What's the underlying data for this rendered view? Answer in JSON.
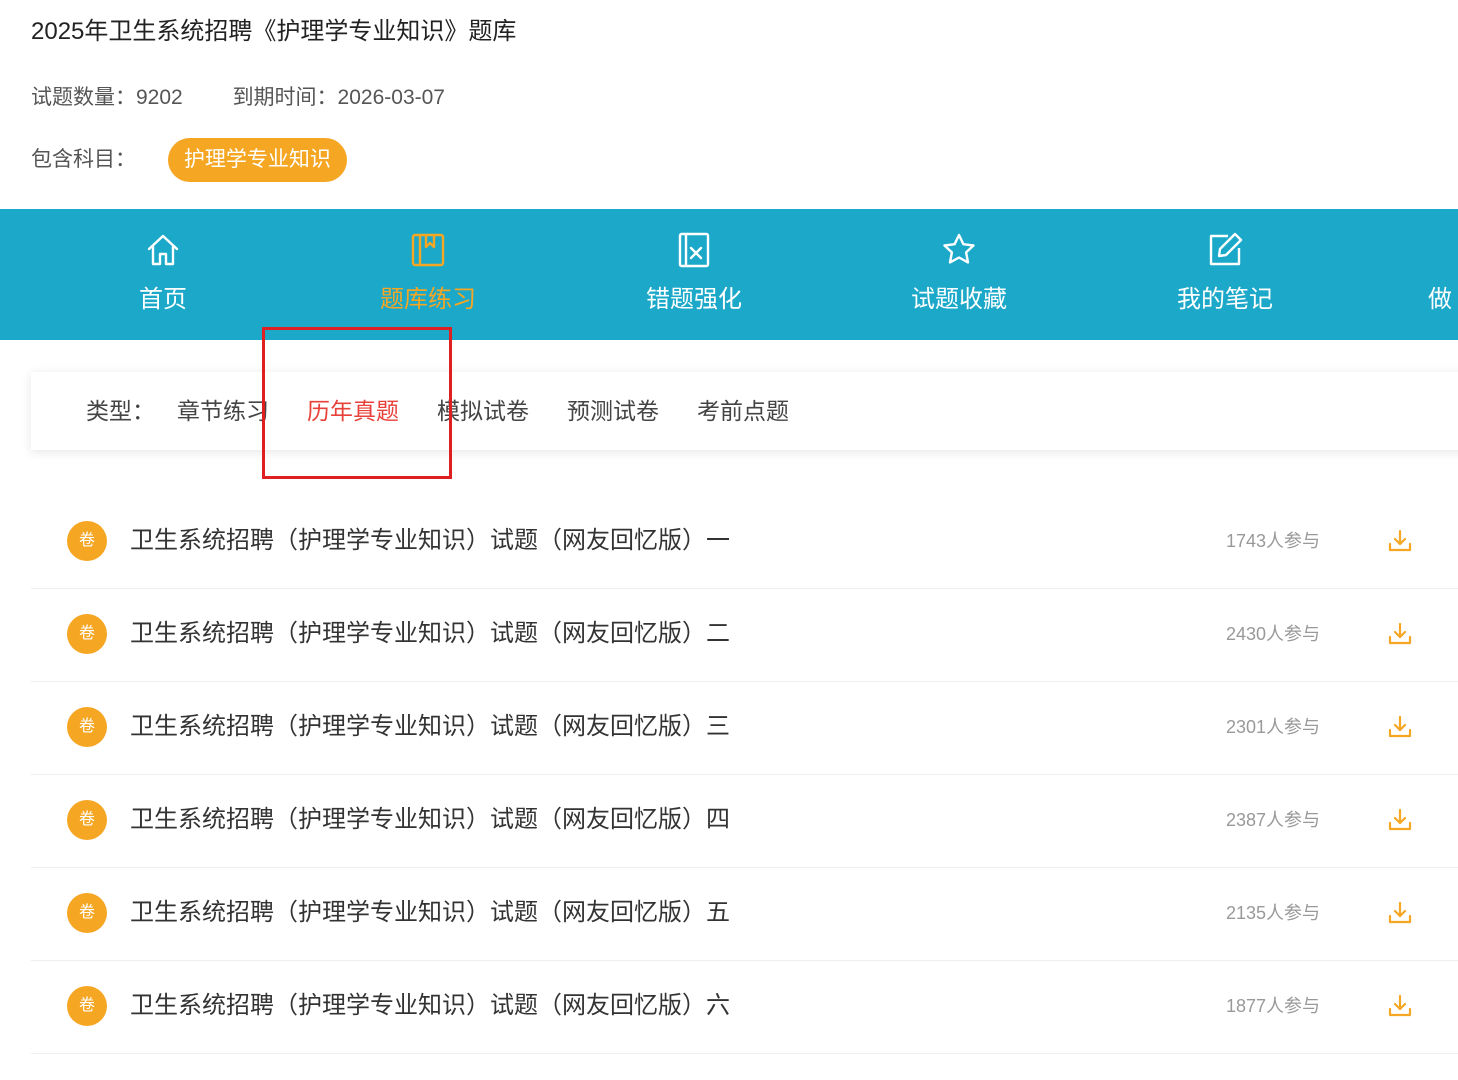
{
  "bank": {
    "title": "2025年卫生系统招聘《护理学专业知识》题库",
    "question_count": "试题数量：9202",
    "expiry": "到期时间：2026-03-07",
    "subjects_label": "包含科目：",
    "subject_tag": "护理学专业知识"
  },
  "colors": {
    "nav_background": "#1ba8c9",
    "accent_orange": "#f5a623",
    "active_type_red": "#e8413a",
    "annotation_box_red": "#e02020"
  },
  "nav": {
    "items": [
      {
        "label": "首页",
        "icon": "home-icon",
        "active": false
      },
      {
        "label": "题库练习",
        "icon": "book-icon",
        "active": true
      },
      {
        "label": "错题强化",
        "icon": "wrong-question-icon",
        "active": false
      },
      {
        "label": "试题收藏",
        "icon": "star-icon",
        "active": false
      },
      {
        "label": "我的笔记",
        "icon": "edit-note-icon",
        "active": false
      },
      {
        "label": "做",
        "icon": "",
        "active": false
      }
    ]
  },
  "types": {
    "label": "类型：",
    "options": [
      "章节练习",
      "历年真题",
      "模拟试卷",
      "预测试卷",
      "考前点题"
    ],
    "selected": "历年真题"
  },
  "papers": [
    {
      "badge": "卷",
      "title": "卫生系统招聘（护理学专业知识）试题（网友回忆版）一",
      "participants": "1743人参与",
      "icon": "download-icon"
    },
    {
      "badge": "卷",
      "title": "卫生系统招聘（护理学专业知识）试题（网友回忆版）二",
      "participants": "2430人参与",
      "icon": "download-icon"
    },
    {
      "badge": "卷",
      "title": "卫生系统招聘（护理学专业知识）试题（网友回忆版）三",
      "participants": "2301人参与",
      "icon": "download-icon"
    },
    {
      "badge": "卷",
      "title": "卫生系统招聘（护理学专业知识）试题（网友回忆版）四",
      "participants": "2387人参与",
      "icon": "download-icon"
    },
    {
      "badge": "卷",
      "title": "卫生系统招聘（护理学专业知识）试题（网友回忆版）五",
      "participants": "2135人参与",
      "icon": "download-icon"
    },
    {
      "badge": "卷",
      "title": "卫生系统招聘（护理学专业知识）试题（网友回忆版）六",
      "participants": "1877人参与",
      "icon": "download-icon"
    }
  ]
}
